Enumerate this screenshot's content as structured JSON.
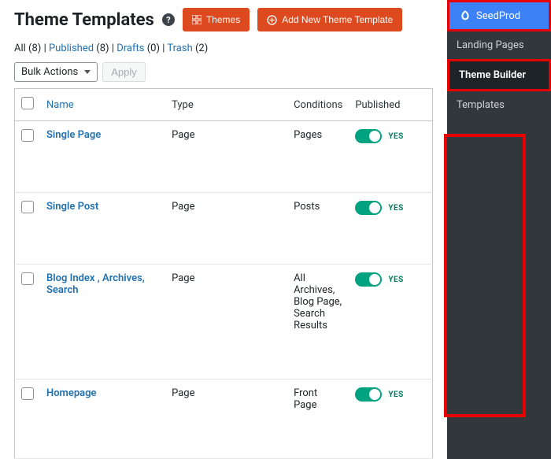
{
  "sidebar": {
    "brand": "SeedProd",
    "items": [
      {
        "label": "Landing Pages",
        "active": false
      },
      {
        "label": "Theme Builder",
        "active": true
      },
      {
        "label": "Templates",
        "active": false
      }
    ]
  },
  "header": {
    "title": "Theme Templates",
    "themes_btn": "Themes",
    "add_btn": "Add New Theme Template"
  },
  "filters": {
    "all_label": "All",
    "all_count": "(8)",
    "published_label": "Published",
    "published_count": "(8)",
    "drafts_label": "Drafts",
    "drafts_count": "(0)",
    "trash_label": "Trash",
    "trash_count": "(2)"
  },
  "bulk": {
    "select_label": "Bulk Actions",
    "apply_label": "Apply"
  },
  "columns": {
    "name": "Name",
    "type": "Type",
    "conditions": "Conditions",
    "published": "Published"
  },
  "rows": [
    {
      "name": "Single Page",
      "type": "Page",
      "conditions": "Pages",
      "toggle": "YES"
    },
    {
      "name": "Single Post",
      "type": "Page",
      "conditions": "Posts",
      "toggle": "YES"
    },
    {
      "name": "Blog Index , Archives, Search",
      "type": "Page",
      "conditions": "All Archives, Blog Page, Search Results",
      "toggle": "YES"
    },
    {
      "name": "Homepage",
      "type": "Page",
      "conditions": "Front Page",
      "toggle": "YES"
    }
  ]
}
